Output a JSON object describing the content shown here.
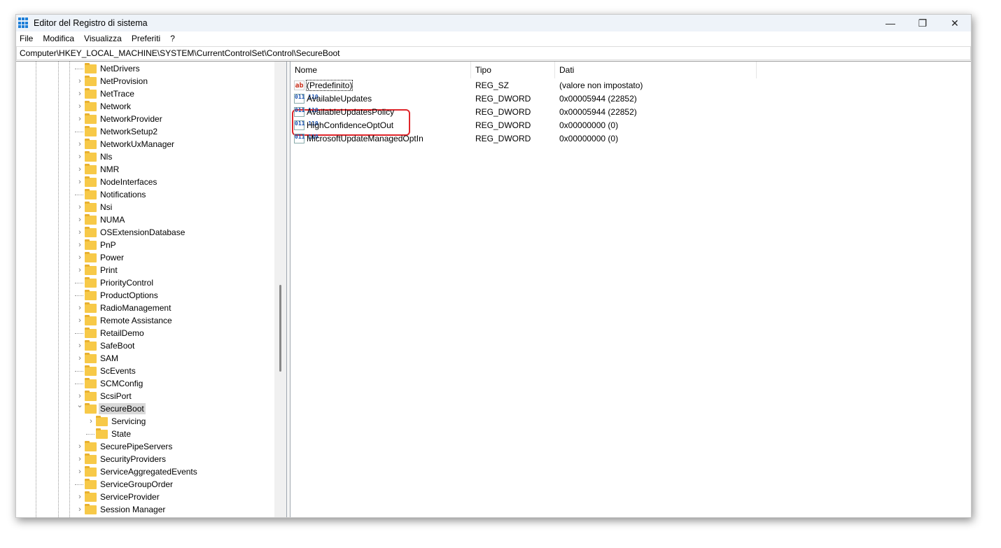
{
  "window": {
    "title": "Editor del Registro di sistema",
    "minimize": "—",
    "restore": "❐",
    "close": "✕"
  },
  "menu": [
    "File",
    "Modifica",
    "Visualizza",
    "Preferiti",
    "?"
  ],
  "address": "Computer\\HKEY_LOCAL_MACHINE\\SYSTEM\\CurrentControlSet\\Control\\SecureBoot",
  "tree": [
    {
      "label": "NetDrivers",
      "expandable": false
    },
    {
      "label": "NetProvision",
      "expandable": true
    },
    {
      "label": "NetTrace",
      "expandable": true
    },
    {
      "label": "Network",
      "expandable": true
    },
    {
      "label": "NetworkProvider",
      "expandable": true
    },
    {
      "label": "NetworkSetup2",
      "expandable": false
    },
    {
      "label": "NetworkUxManager",
      "expandable": true
    },
    {
      "label": "Nls",
      "expandable": true
    },
    {
      "label": "NMR",
      "expandable": true
    },
    {
      "label": "NodeInterfaces",
      "expandable": true
    },
    {
      "label": "Notifications",
      "expandable": false
    },
    {
      "label": "Nsi",
      "expandable": true
    },
    {
      "label": "NUMA",
      "expandable": true
    },
    {
      "label": "OSExtensionDatabase",
      "expandable": true
    },
    {
      "label": "PnP",
      "expandable": true
    },
    {
      "label": "Power",
      "expandable": true
    },
    {
      "label": "Print",
      "expandable": true
    },
    {
      "label": "PriorityControl",
      "expandable": false
    },
    {
      "label": "ProductOptions",
      "expandable": false
    },
    {
      "label": "RadioManagement",
      "expandable": true
    },
    {
      "label": "Remote Assistance",
      "expandable": true
    },
    {
      "label": "RetailDemo",
      "expandable": false
    },
    {
      "label": "SafeBoot",
      "expandable": true
    },
    {
      "label": "SAM",
      "expandable": true
    },
    {
      "label": "ScEvents",
      "expandable": false
    },
    {
      "label": "SCMConfig",
      "expandable": false
    },
    {
      "label": "ScsiPort",
      "expandable": true
    },
    {
      "label": "SecureBoot",
      "expandable": true,
      "expanded": true,
      "selected": true
    },
    {
      "label": "Servicing",
      "expandable": true,
      "child": true
    },
    {
      "label": "State",
      "expandable": false,
      "child": true
    },
    {
      "label": "SecurePipeServers",
      "expandable": true
    },
    {
      "label": "SecurityProviders",
      "expandable": true
    },
    {
      "label": "ServiceAggregatedEvents",
      "expandable": true
    },
    {
      "label": "ServiceGroupOrder",
      "expandable": false
    },
    {
      "label": "ServiceProvider",
      "expandable": true
    },
    {
      "label": "Session Manager",
      "expandable": true
    }
  ],
  "columns": {
    "name": "Nome",
    "type": "Tipo",
    "data": "Dati"
  },
  "values": [
    {
      "name": "(Predefinito)",
      "type": "REG_SZ",
      "data": "(valore non impostato)",
      "icon": "string"
    },
    {
      "name": "AvailableUpdates",
      "type": "REG_DWORD",
      "data": "0x00005944 (22852)",
      "icon": "binary"
    },
    {
      "name": "AvailableUpdatesPolicy",
      "type": "REG_DWORD",
      "data": "0x00005944 (22852)",
      "icon": "binary"
    },
    {
      "name": "HighConfidenceOptOut",
      "type": "REG_DWORD",
      "data": "0x00000000 (0)",
      "icon": "binary"
    },
    {
      "name": "MicrosoftUpdateManagedOptIn",
      "type": "REG_DWORD",
      "data": "0x00000000 (0)",
      "icon": "binary"
    }
  ],
  "icon_text": {
    "string": "ab",
    "binary": "011 110"
  },
  "colors": {
    "highlight": "#e0262b",
    "folder": "#f7c948"
  }
}
